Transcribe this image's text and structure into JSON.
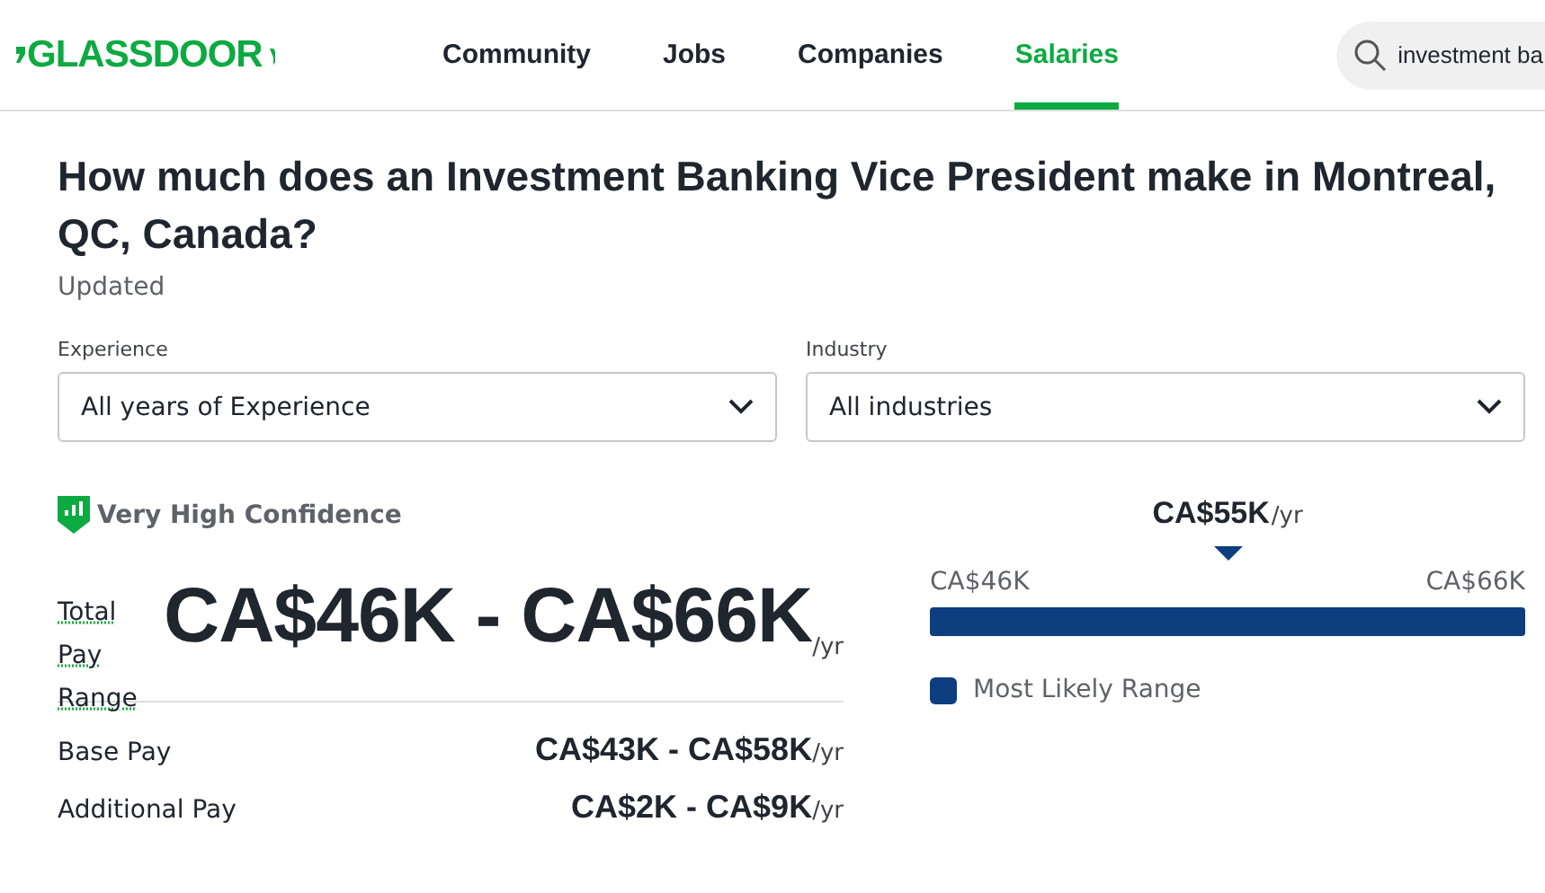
{
  "header": {
    "logo": "GLASSDOOR",
    "nav": [
      {
        "label": "Community",
        "selected": false
      },
      {
        "label": "Jobs",
        "selected": false
      },
      {
        "label": "Companies",
        "selected": false
      },
      {
        "label": "Salaries",
        "selected": true
      }
    ],
    "search": {
      "value": "investment ba"
    }
  },
  "title": "How much does an Investment Banking Vice President make in Montreal, QC, Canada?",
  "updated": "Updated",
  "filters": [
    {
      "label": "Experience",
      "value": "All years of Experience"
    },
    {
      "label": "Industry",
      "value": "All industries"
    }
  ],
  "confidence": "Very High Confidence",
  "total": {
    "label": "Total Pay Range",
    "value": "CA$46K - CA$66K",
    "unit": "/yr"
  },
  "breakdown": [
    {
      "label": "Base Pay",
      "value": "CA$43K - CA$58K",
      "unit": "/yr"
    },
    {
      "label": "Additional Pay",
      "value": "CA$2K - CA$9K",
      "unit": "/yr"
    }
  ],
  "range": {
    "median": "CA$55K",
    "unit": "/yr",
    "low": "CA$46K",
    "high": "CA$66K",
    "level": 1,
    "legend": "Most Likely Range"
  }
}
